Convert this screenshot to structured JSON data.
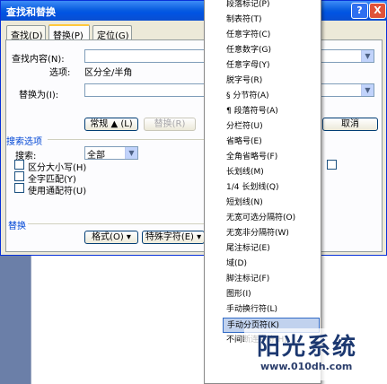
{
  "window": {
    "title": "查找和替换",
    "help": "?",
    "close": "X"
  },
  "tabs": [
    {
      "label": "查找(D)"
    },
    {
      "label": "替换(P)"
    },
    {
      "label": "定位(G)"
    }
  ],
  "find": {
    "label": "查找内容(N):",
    "options_label": "选项:",
    "options_value": "区分全/半角",
    "value": ""
  },
  "replace": {
    "label": "替换为(I):",
    "value": ""
  },
  "buttons": {
    "normal": "常规 ▲ (L)",
    "replace": "替换(R)",
    "cancel": "取消"
  },
  "search_options": {
    "section_title": "搜索选项",
    "search_label": "搜索:",
    "search_value": "全部",
    "checkboxes": [
      {
        "label": "区分大小写(H)",
        "checked": false
      },
      {
        "label": "全字匹配(Y)",
        "checked": false
      },
      {
        "label": "使用通配符(U)",
        "checked": false
      }
    ]
  },
  "replace_section": {
    "title": "替换",
    "format_button": "格式(O) ▾",
    "special_button": "特殊字符(E) ▾"
  },
  "special_menu": {
    "items": [
      "段落标记(P)",
      "制表符(T)",
      "任意字符(C)",
      "任意数字(G)",
      "任意字母(Y)",
      "脱字号(R)",
      "§ 分节符(A)",
      "¶ 段落符号(A)",
      "分栏符(U)",
      "省略号(E)",
      "全角省略号(F)",
      "长划线(M)",
      "1/4 长划线(Q)",
      "短划线(N)",
      "无宽可选分隔符(O)",
      "无宽非分隔符(W)",
      "尾注标记(E)",
      "域(D)",
      "脚注标记(F)",
      "图形(I)",
      "手动换行符(L)",
      "手动分页符(K)",
      "不间断连字符(H)"
    ],
    "selected_index": 21
  },
  "watermark": {
    "title": "阳光系统",
    "url": "www.010dh.com"
  }
}
